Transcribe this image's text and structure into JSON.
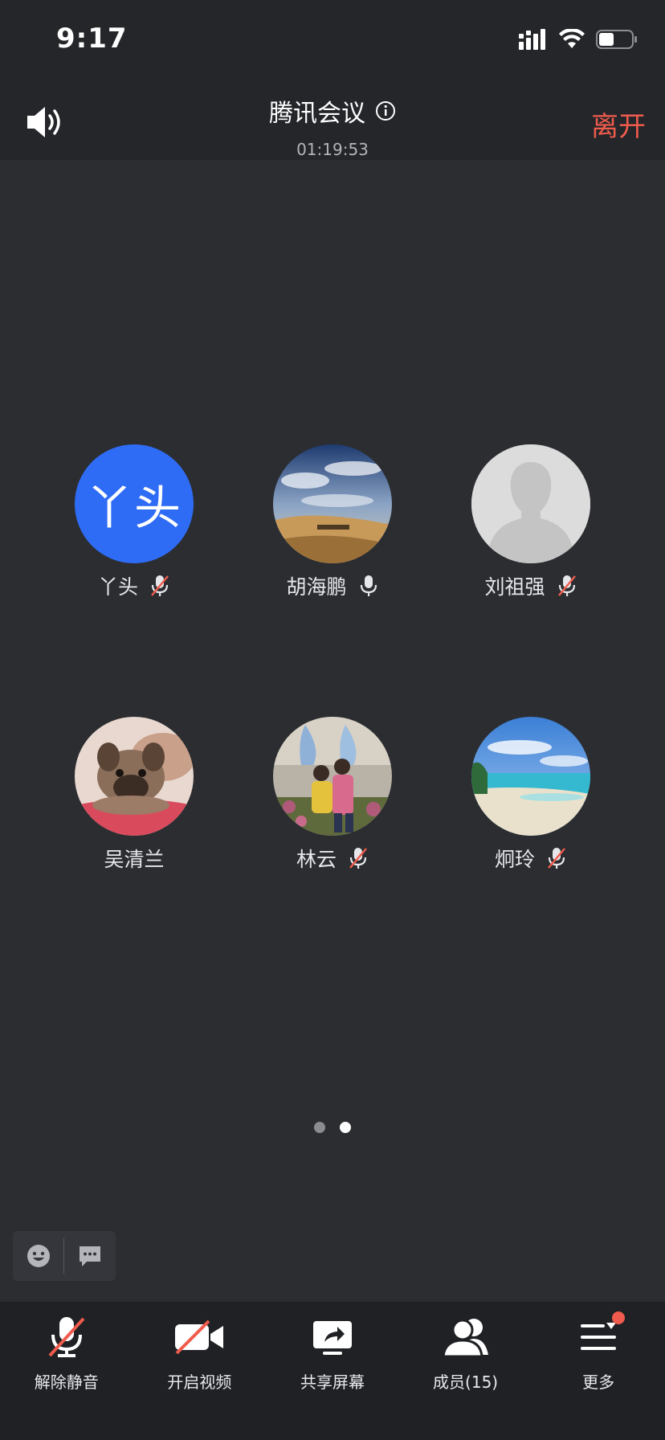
{
  "status_bar": {
    "time": "9:17"
  },
  "header": {
    "title": "腾讯会议",
    "timer": "01:19:53",
    "leave_label": "离开"
  },
  "participants": [
    {
      "name": "丫头",
      "avatar_text": "丫头",
      "avatar": "blue-text",
      "mic": "muted"
    },
    {
      "name": "胡海鹏",
      "avatar": "landscape-photo",
      "mic": "on"
    },
    {
      "name": "刘祖强",
      "avatar": "default-silhouette",
      "mic": "muted"
    },
    {
      "name": "吴清兰",
      "avatar": "puppy-photo",
      "mic": "none"
    },
    {
      "name": "林云",
      "avatar": "people-photo",
      "mic": "muted"
    },
    {
      "name": "炯玲",
      "avatar": "beach-photo",
      "mic": "muted"
    }
  ],
  "pagination": {
    "pages": 2,
    "current": 2
  },
  "toolbar": {
    "unmute_label": "解除静音",
    "video_label": "开启视频",
    "share_label": "共享屏幕",
    "members_label": "成员(15)",
    "more_label": "更多"
  },
  "colors": {
    "accent_red": "#ef5b4c",
    "avatar_blue": "#2f6cf5",
    "background": "#2b2d31",
    "header_bg": "#24262a",
    "toolbar_bg": "#1f2124"
  }
}
